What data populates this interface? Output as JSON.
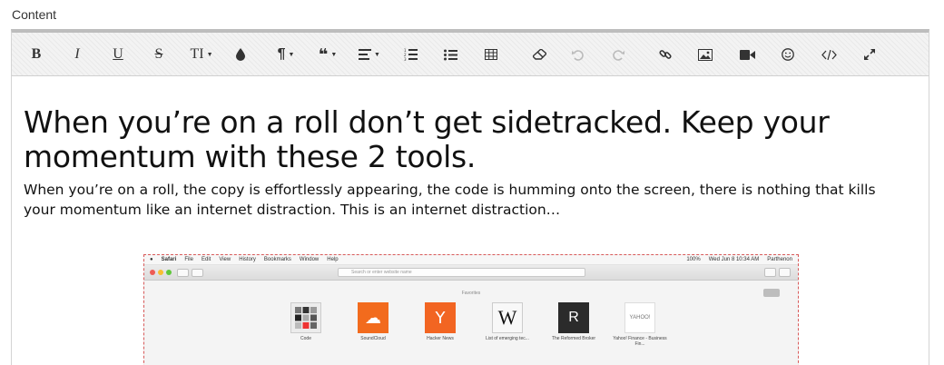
{
  "section_label": "Content",
  "toolbar": {
    "buttons": [
      {
        "name": "bold-button",
        "icon": "bold-icon",
        "glyph": "B",
        "style": "bold-serif"
      },
      {
        "name": "italic-button",
        "icon": "italic-icon",
        "glyph": "I",
        "style": "italic-serif"
      },
      {
        "name": "underline-button",
        "icon": "underline-icon",
        "glyph": "U",
        "style": "underline-serif"
      },
      {
        "name": "strikethrough-button",
        "icon": "strikethrough-icon",
        "glyph": "S",
        "style": "strike-serif"
      },
      {
        "name": "font-size-button",
        "icon": "font-size-icon",
        "glyph": "TI",
        "dropdown": true
      },
      {
        "name": "text-color-button",
        "icon": "color-drop-icon"
      },
      {
        "name": "paragraph-format-button",
        "icon": "pilcrow-icon",
        "glyph": "¶",
        "dropdown": true
      },
      {
        "name": "quote-button",
        "icon": "quote-icon",
        "glyph": "❝",
        "dropdown": true
      },
      {
        "name": "align-button",
        "icon": "align-left-icon",
        "dropdown": true
      },
      {
        "name": "ordered-list-button",
        "icon": "ordered-list-icon"
      },
      {
        "name": "unordered-list-button",
        "icon": "unordered-list-icon"
      },
      {
        "name": "insert-table-button",
        "icon": "table-icon"
      },
      {
        "name": "clear-formatting-button",
        "icon": "eraser-icon"
      },
      {
        "name": "undo-button",
        "icon": "undo-icon",
        "disabled": true
      },
      {
        "name": "redo-button",
        "icon": "redo-icon",
        "disabled": true
      },
      {
        "name": "insert-link-button",
        "icon": "link-icon"
      },
      {
        "name": "insert-image-button",
        "icon": "image-icon"
      },
      {
        "name": "insert-video-button",
        "icon": "video-icon"
      },
      {
        "name": "emoticons-button",
        "icon": "smiley-icon"
      },
      {
        "name": "code-view-button",
        "icon": "code-icon"
      },
      {
        "name": "fullscreen-button",
        "icon": "expand-icon"
      }
    ]
  },
  "content": {
    "heading": "When you’re on a roll don’t get sidetracked. Keep your momentum with these 2 tools.",
    "paragraph": "When you’re on a roll, the copy is effortlessly appearing, the code is humming onto the screen, there is nothing that kills your momentum like an internet distraction. This is an internet distraction…"
  },
  "embedded_screenshot": {
    "menubar": {
      "apple": "",
      "app": "Safari",
      "items": [
        "File",
        "Edit",
        "View",
        "History",
        "Bookmarks",
        "Window",
        "Help"
      ],
      "status": [
        "100%",
        "Wed Jun 8  10:34 AM",
        "Parthenon"
      ]
    },
    "url_placeholder": "Search or enter website name",
    "favorites_label": "Favorites",
    "favorites": [
      {
        "label": "Code",
        "icon": "folder-grid-icon",
        "bg": "#ececec",
        "glyph": ""
      },
      {
        "label": "SoundCloud",
        "icon": "soundcloud-icon",
        "bg": "#f26b1d",
        "glyph": "☁"
      },
      {
        "label": "Hacker News",
        "icon": "hacker-news-icon",
        "bg": "#f26522",
        "glyph": "Y"
      },
      {
        "label": "List of emerging tec...",
        "icon": "wikipedia-icon",
        "bg": "#f8f8f8",
        "glyph": "W"
      },
      {
        "label": "The Reformed Broker",
        "icon": "reformed-broker-icon",
        "bg": "#2b2b2b",
        "glyph": "R"
      },
      {
        "label": "Yahoo! Finance - Business Fin...",
        "icon": "yahoo-icon",
        "bg": "#ffffff",
        "glyph": "YAHOO!"
      }
    ]
  },
  "colors": {
    "accent_dashed_border": "#d85a5a",
    "toolbar_bg": "#f3f3f3"
  }
}
